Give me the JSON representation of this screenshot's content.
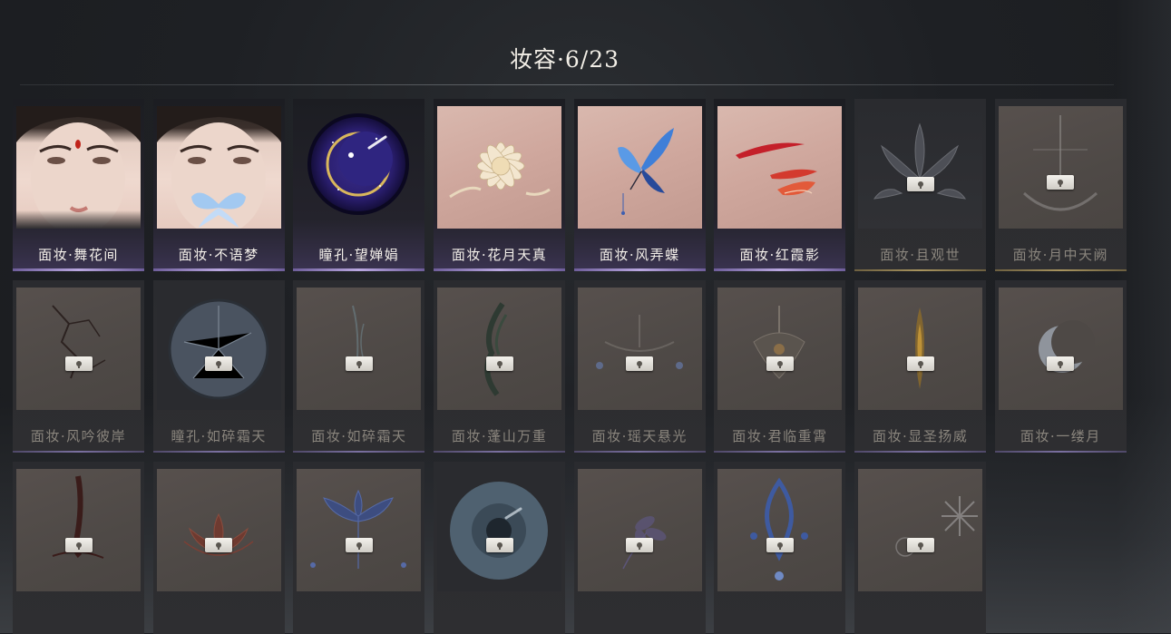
{
  "header": {
    "title": "妆容·6/23"
  },
  "items": [
    {
      "label": "面妆·舞花间",
      "state": "owned",
      "art": "face-bindi-icon"
    },
    {
      "label": "面妆·不语梦",
      "state": "owned",
      "art": "face-butterfly-icon"
    },
    {
      "label": "瞳孔·望婵娟",
      "state": "owned",
      "art": "eye-moon-icon"
    },
    {
      "label": "面妆·花月天真",
      "state": "owned",
      "art": "chrysanthemum-icon"
    },
    {
      "label": "面妆·风弄蝶",
      "state": "owned",
      "art": "blue-butterfly-icon"
    },
    {
      "label": "面妆·红霞影",
      "state": "owned",
      "art": "red-petals-icon"
    },
    {
      "label": "面妆·且观世",
      "state": "locked",
      "art": "dark-lotus-icon"
    },
    {
      "label": "面妆·月中天阙",
      "state": "locked",
      "art": "moon-glow-icon"
    },
    {
      "label": "面妆·风吟彼岸",
      "state": "locked",
      "art": "crack-pattern-icon"
    },
    {
      "label": "瞳孔·如碎霜天",
      "state": "locked",
      "art": "frost-eye-icon"
    },
    {
      "label": "面妆·如碎霜天",
      "state": "locked",
      "art": "frost-streak-icon"
    },
    {
      "label": "面妆·蓬山万重",
      "state": "locked",
      "art": "mountain-swirl-icon"
    },
    {
      "label": "面妆·瑶天悬光",
      "state": "locked",
      "art": "hanging-light-icon"
    },
    {
      "label": "面妆·君临重霄",
      "state": "locked",
      "art": "crown-ornament-icon"
    },
    {
      "label": "面妆·显圣扬威",
      "state": "locked",
      "art": "flame-mark-icon"
    },
    {
      "label": "面妆·一缕月",
      "state": "locked",
      "art": "crescent-moon-icon"
    },
    {
      "label": "",
      "state": "locked",
      "art": "brush-stroke-icon"
    },
    {
      "label": "",
      "state": "locked",
      "art": "red-lotus-icon"
    },
    {
      "label": "",
      "state": "locked",
      "art": "blue-lotus-icon"
    },
    {
      "label": "",
      "state": "locked",
      "art": "blue-eye-icon"
    },
    {
      "label": "",
      "state": "locked",
      "art": "purple-flower-icon"
    },
    {
      "label": "",
      "state": "locked",
      "art": "blue-bead-icon"
    },
    {
      "label": "",
      "state": "locked",
      "art": "snowflake-icon"
    }
  ],
  "colors": {
    "owned_accent": "#b9a7e0",
    "locked_label": "#8a857d",
    "title": "#f2eee6"
  }
}
